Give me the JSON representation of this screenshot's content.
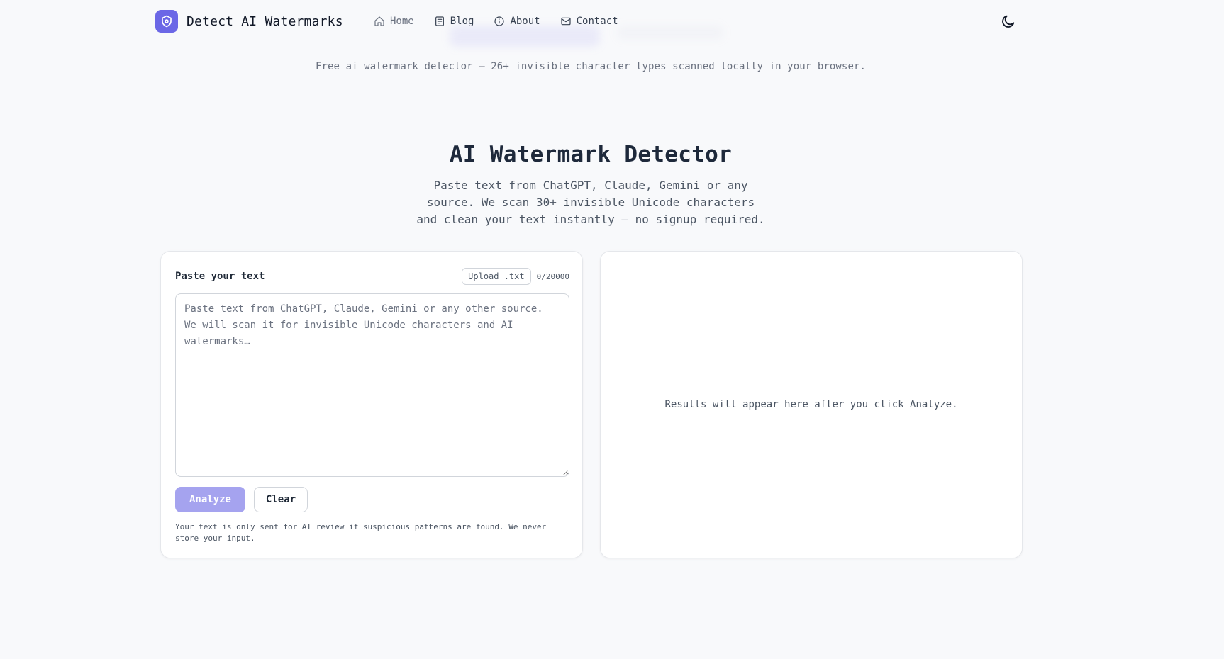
{
  "brand": {
    "name": "Detect AI Watermarks",
    "logo_icon": "shield-logo-icon",
    "accent": "#6b67e6"
  },
  "nav": {
    "items": [
      {
        "label": "Home",
        "icon": "home-icon"
      },
      {
        "label": "Blog",
        "icon": "newspaper-icon"
      },
      {
        "label": "About",
        "icon": "info-icon"
      },
      {
        "label": "Contact",
        "icon": "mail-icon"
      }
    ]
  },
  "theme_toggle": {
    "icon": "moon-icon"
  },
  "tagline": "Free ai watermark detector — 26+ invisible character types scanned locally in your browser.",
  "hero": {
    "title": "AI Watermark Detector",
    "subtitle": "Paste text from ChatGPT, Claude, Gemini or any source. We scan 30+ invisible Unicode characters and clean your text instantly — no signup required."
  },
  "input_card": {
    "label": "Paste your text",
    "upload_label": "Upload .txt",
    "char_count": "0/20000",
    "textarea_value": "",
    "textarea_placeholder": "Paste text from ChatGPT, Claude, Gemini or any other source. We will scan it for invisible Unicode characters and AI watermarks…",
    "analyze_label": "Analyze",
    "clear_label": "Clear",
    "privacy_note": "Your text is only sent for AI review if suspicious patterns are found. We never store your input."
  },
  "results_card": {
    "placeholder": "Results will appear here after you click Analyze."
  },
  "colors": {
    "background": "#f8f9fb",
    "analyze_button": "#a5a3ef"
  }
}
